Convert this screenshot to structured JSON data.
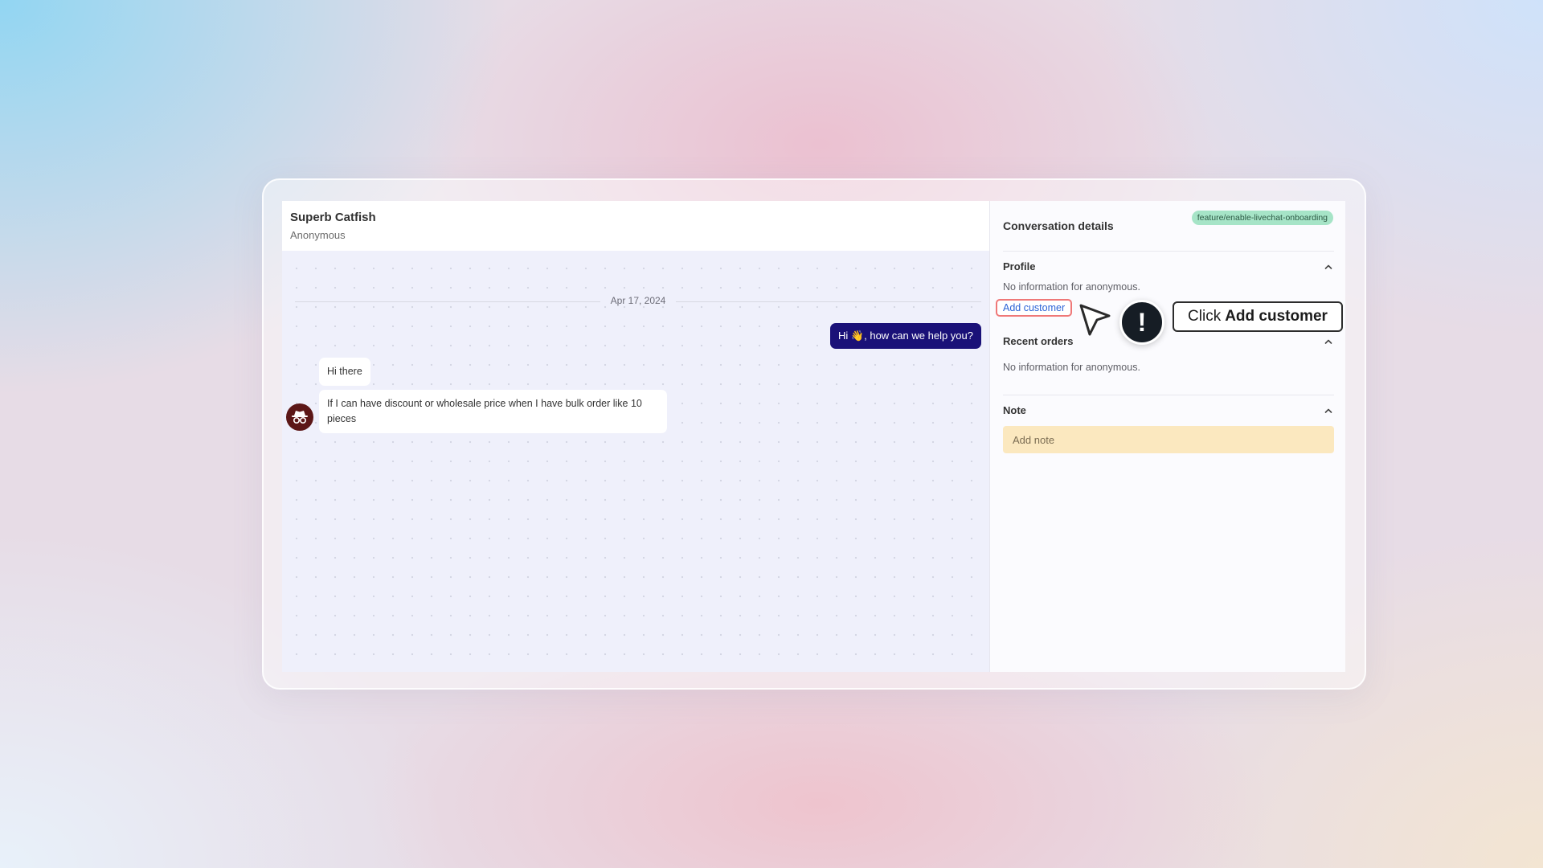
{
  "chat": {
    "title": "Superb Catfish",
    "subtitle": "Anonymous",
    "date_divider": "Apr 17, 2024",
    "messages": [
      {
        "direction": "outgoing",
        "text": "Hi 👋, how can we help you?"
      },
      {
        "direction": "incoming",
        "text": "Hi there"
      },
      {
        "direction": "incoming",
        "text": "If I can have discount or wholesale price when I have bulk order like 10 pieces"
      }
    ],
    "avatar_icon": "incognito-icon"
  },
  "details": {
    "title": "Conversation details",
    "branch_badge": "feature/enable-livechat-onboarding",
    "profile": {
      "title": "Profile",
      "text": "No information for anonymous.",
      "add_customer_label": "Add customer"
    },
    "recent_orders": {
      "title": "Recent orders",
      "text": "No information for anonymous."
    },
    "note": {
      "title": "Note",
      "placeholder": "Add note"
    }
  },
  "tutorial": {
    "prefix": "Click",
    "target": "Add customer",
    "alert_glyph": "!"
  },
  "colors": {
    "outgoing_bubble": "#1a1178",
    "badge_bg": "#a6e4c7",
    "link": "#2b63d6",
    "highlight_border": "#ef7878",
    "note_bg": "#fbe8bf"
  }
}
